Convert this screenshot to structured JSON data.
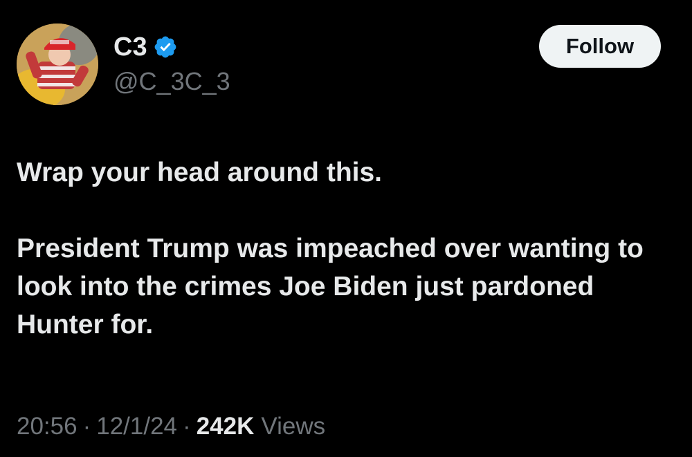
{
  "author": {
    "display_name": "C3",
    "handle": "@C_3C_3",
    "verified": true,
    "verified_color": "#1d9bf0",
    "avatar_icon": "avatar-photo"
  },
  "follow_button": {
    "label": "Follow"
  },
  "tweet": {
    "paragraphs": [
      "Wrap your head around this.",
      "President Trump was impeached over wanting to look into the crimes Joe Biden just pardoned Hunter for."
    ]
  },
  "meta": {
    "time": "20:56",
    "separator": "·",
    "date": "12/1/24",
    "views_count": "242K",
    "views_label": "Views"
  }
}
